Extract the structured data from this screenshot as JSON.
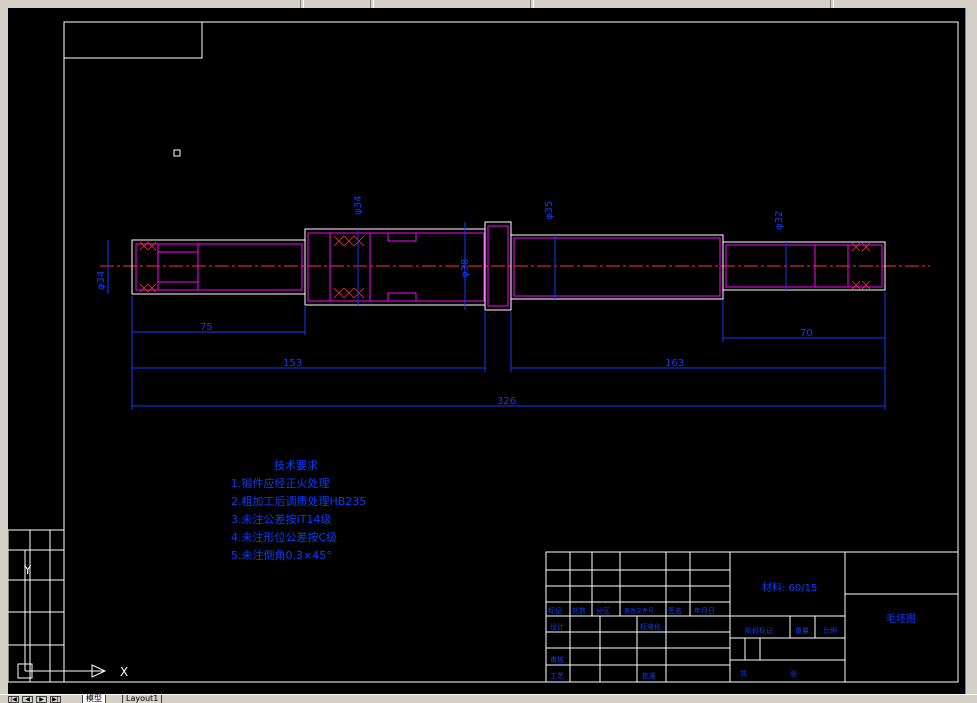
{
  "tabs": [
    {
      "label": "模型"
    },
    {
      "label": "Layout1"
    }
  ],
  "drawing": {
    "dimensions": {
      "d75": "75",
      "d70": "70",
      "d153": "153",
      "d163": "163",
      "d326": "326",
      "dia_left": "φ34",
      "dia_mid": "φ34",
      "dia_collar": "φ38",
      "dia_right_mid": "φ35",
      "dia_right": "φ32"
    },
    "notes": {
      "title": "技术要求",
      "items": [
        "1.锻件应经正火处理",
        "2.粗加工后调质处理HB235",
        "3.未注公差按IT14级",
        "4.未注形位公差按C级",
        "5.未注倒角0.3×45°"
      ]
    },
    "title_block": {
      "material": "材料: 60/15",
      "name": "毛坯图",
      "row_labels": [
        "标记",
        "处数",
        "分区",
        "更改文件号",
        "签名",
        "年月日"
      ],
      "design": "设计",
      "standard": "标准化",
      "review": "审核",
      "process": "工艺",
      "approve": "批准",
      "stage": "阶段标记",
      "weight": "重量",
      "scale": "比例",
      "sheets": "共",
      "sheet": "张"
    }
  },
  "ucs": {
    "x_label": "X",
    "y_label": "Y"
  },
  "colors": {
    "canvas": "#000000",
    "line": "#ffffff",
    "dim": "#0a3cff",
    "part": "#ff00ff",
    "center": "#ff3030"
  }
}
